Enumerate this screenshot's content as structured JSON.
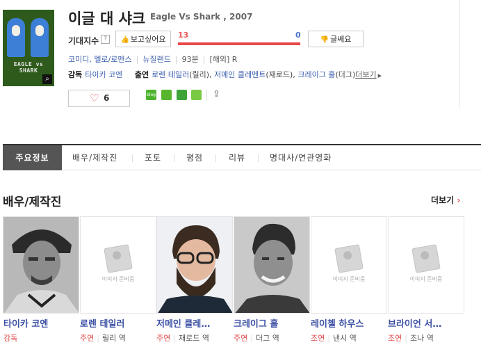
{
  "movie": {
    "title": "이글 대 샤크",
    "subtitle": "Eagle Vs Shark , 2007",
    "poster_text": "EAGLE vs SHARK"
  },
  "expect": {
    "label": "기대지수",
    "help": "?",
    "want_label": "보고싶어요",
    "want_count": "13",
    "no_label": "글쎄요",
    "no_count": "0",
    "want_fraction": 1.0
  },
  "meta": {
    "genre": "코미디, 멜로/로맨스",
    "country": "뉴질랜드",
    "runtime": "93분",
    "rating": "[해외] R"
  },
  "credits": {
    "director_label": "감독",
    "director": "타이카 코엔",
    "cast_label": "출연",
    "cast": [
      "로렌 테일러",
      "저메인 클레멘트",
      "크레이그 홀"
    ],
    "cast_roles": [
      "(릴리)",
      "(재로드)",
      "(더그)"
    ],
    "more": "더보기"
  },
  "like": {
    "count": "6"
  },
  "sns": {
    "blog": "blog"
  },
  "tabs": [
    "주요정보",
    "배우/제작진",
    "포토",
    "평점",
    "리뷰",
    "명대사/연관영화"
  ],
  "section": {
    "title": "배우/제작진",
    "more": "더보기"
  },
  "people": [
    {
      "name": "타이카 코엔",
      "role": "감독",
      "char": "",
      "photo": "man-cap-bw"
    },
    {
      "name": "로렌 테일러",
      "role": "주연",
      "char": "릴리 역",
      "photo": "none"
    },
    {
      "name": "저메인 클레…",
      "role": "주연",
      "char": "재로드 역",
      "photo": "man-beard-glasses"
    },
    {
      "name": "크레이그 홀",
      "role": "주연",
      "char": "더그 역",
      "photo": "man-smile-bw"
    },
    {
      "name": "레이첼 하우스",
      "role": "조연",
      "char": "낸시 역",
      "photo": "none"
    },
    {
      "name": "브라이언 서…",
      "role": "조연",
      "char": "조나 역",
      "photo": "none"
    }
  ],
  "placeholder_text": "이미지 준비중"
}
